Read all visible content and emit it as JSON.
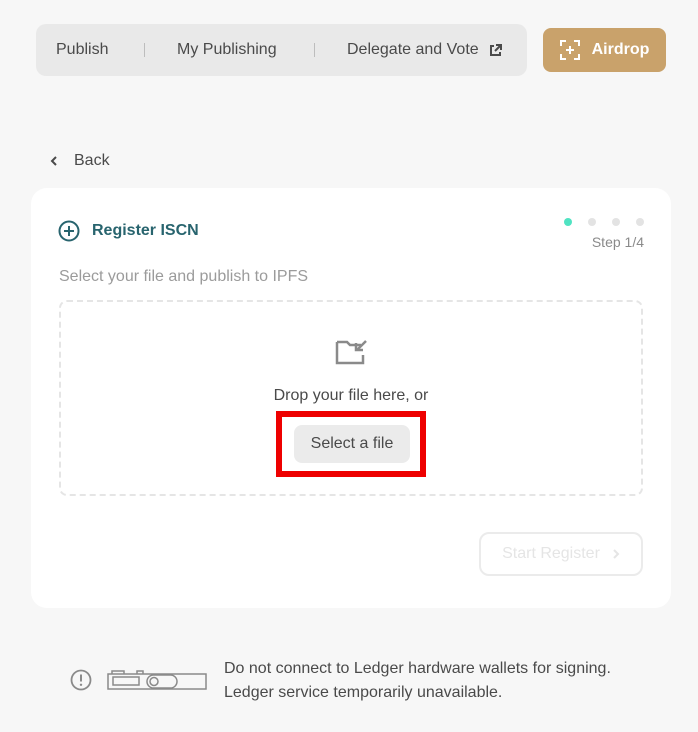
{
  "nav": {
    "publish": "Publish",
    "my_publishing": "My Publishing",
    "delegate_vote": "Delegate and Vote",
    "delegate_icon": "external-link-icon"
  },
  "airdrop": {
    "label": "Airdrop",
    "icon": "scan-plus-icon"
  },
  "back": {
    "label": "Back"
  },
  "card": {
    "title": "Register ISCN",
    "title_icon": "plus-circle-icon",
    "step": "Step 1/4",
    "current_step": 1,
    "total_steps": 4,
    "subtitle": "Select your file and publish to IPFS",
    "drop_text": "Drop your file here, or",
    "select_label": "Select a file",
    "register_label": "Start Register"
  },
  "footer": {
    "line1": "Do not connect to Ledger hardware wallets for signing.",
    "line2": "Ledger service temporarily unavailable."
  },
  "colors": {
    "accent_gold": "#c9a26b",
    "teal_title": "#28646e",
    "active_dot": "#50e3c2",
    "highlight_red": "#ee0000"
  }
}
